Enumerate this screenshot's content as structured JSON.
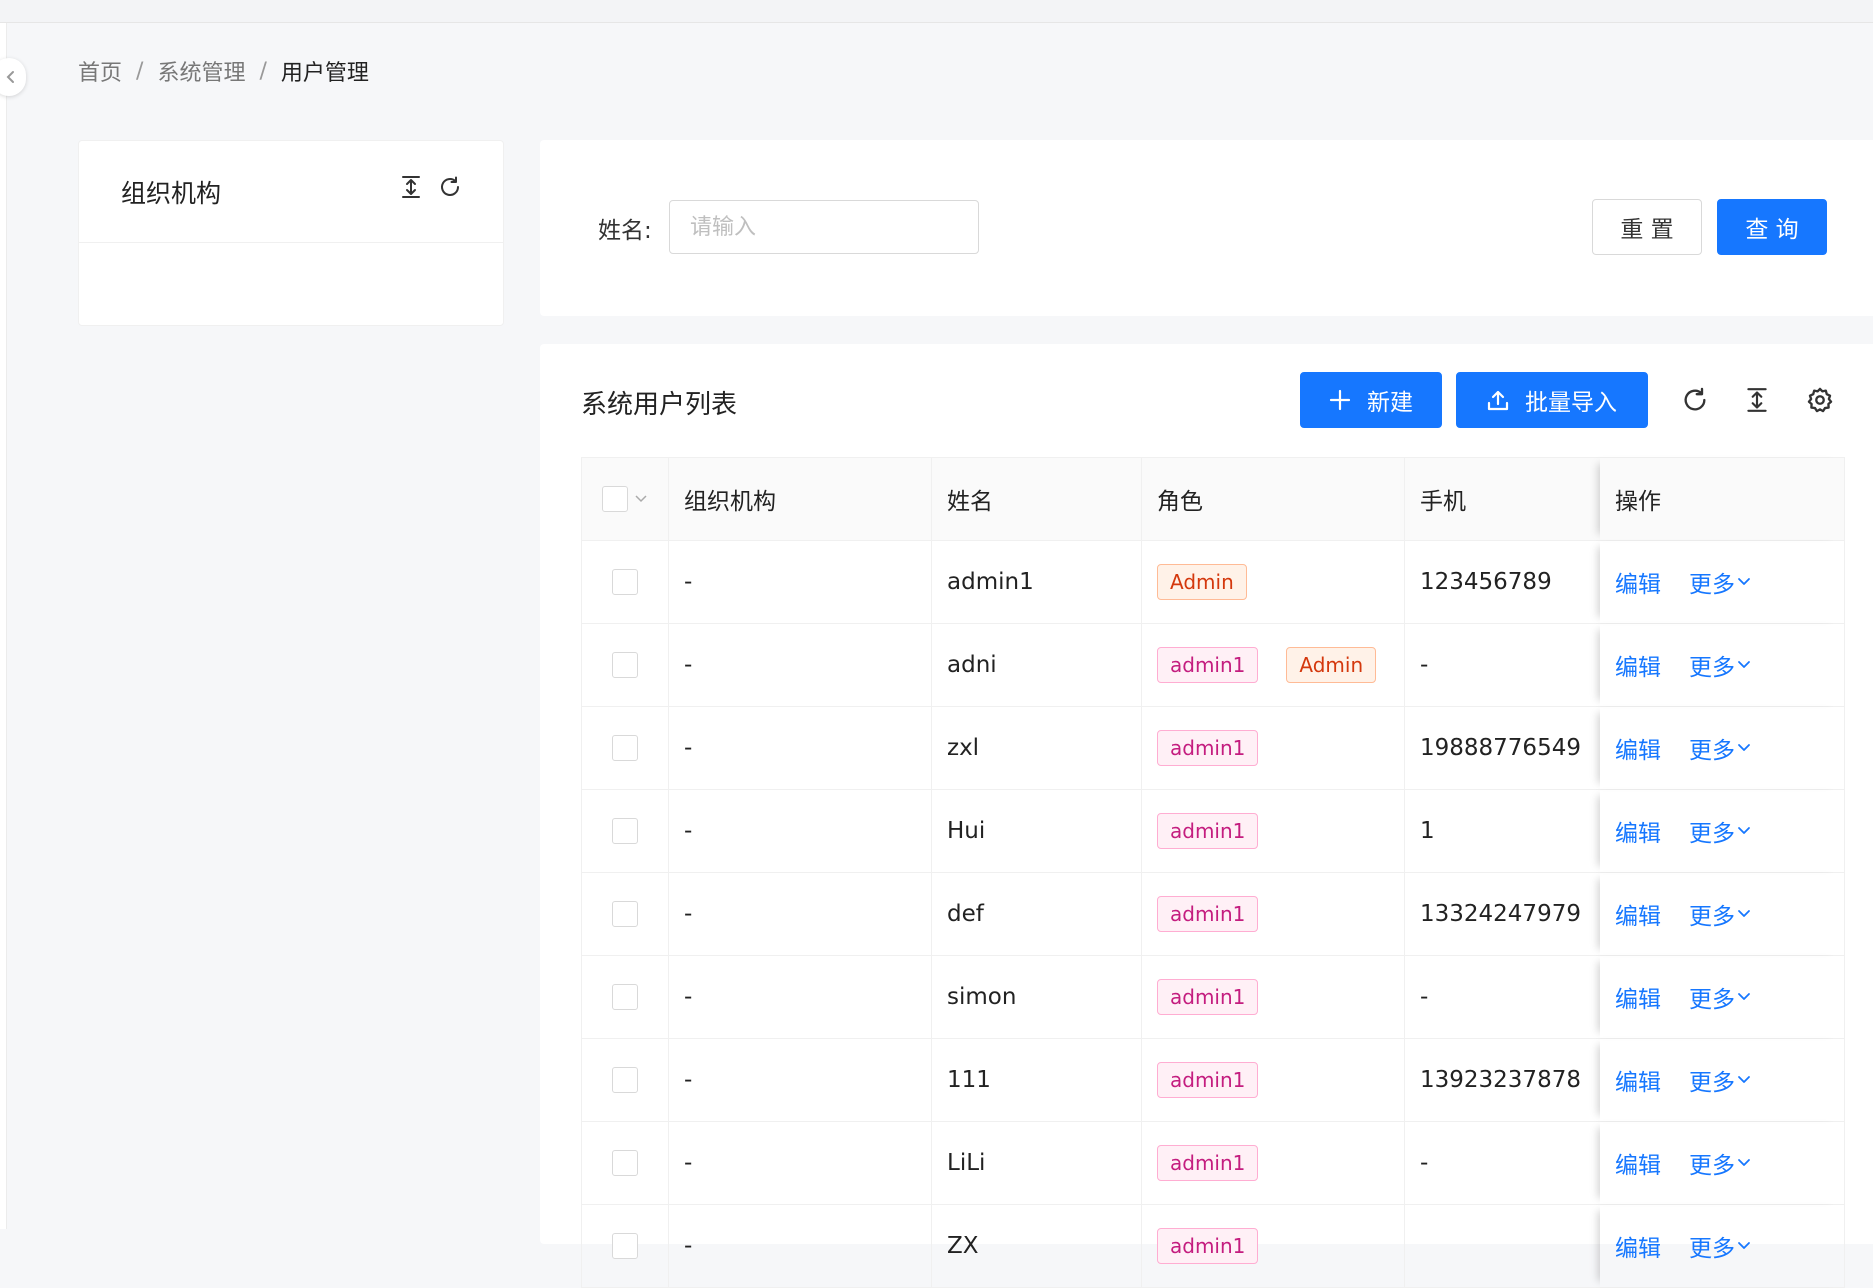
{
  "breadcrumb": {
    "home": "首页",
    "section": "系统管理",
    "current": "用户管理",
    "separator": "/"
  },
  "org_panel": {
    "title": "组织机构",
    "icons": [
      "collapse-vertical-icon",
      "refresh-icon"
    ]
  },
  "search": {
    "name_label": "姓名:",
    "name_placeholder": "请输入",
    "name_value": "",
    "reset_label": "重 置",
    "query_label": "查 询"
  },
  "list": {
    "title": "系统用户列表",
    "new_label": "新建",
    "import_label": "批量导入",
    "toolbar_icons": [
      "refresh-icon",
      "density-icon",
      "settings-icon"
    ]
  },
  "table": {
    "columns": [
      "组织机构",
      "姓名",
      "角色",
      "手机",
      "操作"
    ],
    "rows": [
      {
        "org": "-",
        "name": "admin1",
        "roles": [
          {
            "text": "Admin",
            "color": "orange"
          }
        ],
        "phone": "123456789",
        "edit": "编辑",
        "more": "更多"
      },
      {
        "org": "-",
        "name": "adni",
        "roles": [
          {
            "text": "admin1",
            "color": "magenta"
          },
          {
            "text": "Admin",
            "color": "orange"
          }
        ],
        "phone": "-",
        "edit": "编辑",
        "more": "更多"
      },
      {
        "org": "-",
        "name": "zxl",
        "roles": [
          {
            "text": "admin1",
            "color": "magenta"
          }
        ],
        "phone": "19888776549",
        "edit": "编辑",
        "more": "更多"
      },
      {
        "org": "-",
        "name": "Hui",
        "roles": [
          {
            "text": "admin1",
            "color": "magenta"
          }
        ],
        "phone": "1",
        "edit": "编辑",
        "more": "更多"
      },
      {
        "org": "-",
        "name": "def",
        "roles": [
          {
            "text": "admin1",
            "color": "magenta"
          }
        ],
        "phone": "13324247979",
        "edit": "编辑",
        "more": "更多"
      },
      {
        "org": "-",
        "name": "simon",
        "roles": [
          {
            "text": "admin1",
            "color": "magenta"
          }
        ],
        "phone": "-",
        "edit": "编辑",
        "more": "更多"
      },
      {
        "org": "-",
        "name": "111",
        "roles": [
          {
            "text": "admin1",
            "color": "magenta"
          }
        ],
        "phone": "13923237878",
        "edit": "编辑",
        "more": "更多"
      },
      {
        "org": "-",
        "name": "LiLi",
        "roles": [
          {
            "text": "admin1",
            "color": "magenta"
          }
        ],
        "phone": "-",
        "edit": "编辑",
        "more": "更多"
      },
      {
        "org": "-",
        "name": "ZX",
        "roles": [
          {
            "text": "admin1",
            "color": "magenta"
          }
        ],
        "phone": "",
        "edit": "编辑",
        "more": "更多"
      }
    ]
  },
  "colors": {
    "primary": "#1677ff",
    "magenta_tag": "#c41d7f",
    "orange_tag": "#d4380d"
  }
}
